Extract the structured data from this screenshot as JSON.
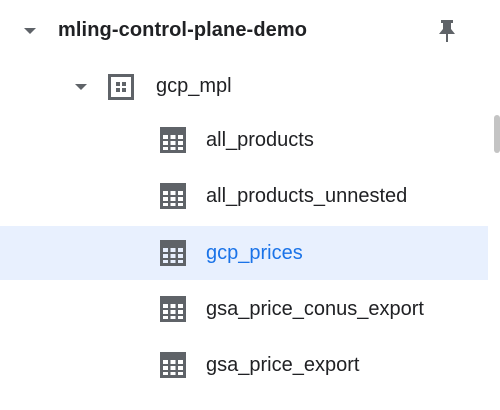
{
  "project": {
    "name": "mling-control-plane-demo",
    "expand_icon": "chevron-down-icon",
    "pin_icon": "pin-icon"
  },
  "dataset": {
    "name": "gcp_mpl",
    "expand_icon": "chevron-down-icon",
    "icon": "dataset-icon"
  },
  "tables": [
    {
      "name": "all_products",
      "icon": "table-icon",
      "selected": false
    },
    {
      "name": "all_products_unnested",
      "icon": "table-icon",
      "selected": false
    },
    {
      "name": "gcp_prices",
      "icon": "table-icon",
      "selected": true
    },
    {
      "name": "gsa_price_conus_export",
      "icon": "table-icon",
      "selected": false
    },
    {
      "name": "gsa_price_export",
      "icon": "table-icon",
      "selected": false
    }
  ],
  "colors": {
    "selected_bg": "#e8f0fe",
    "selected_text": "#1a73e8",
    "icon": "#5f6368",
    "text": "#202124"
  }
}
